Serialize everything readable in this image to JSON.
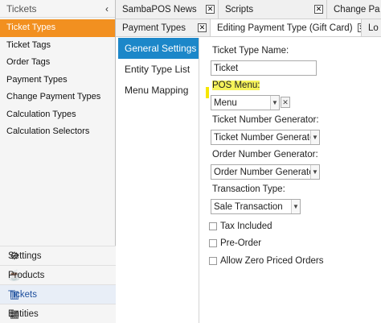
{
  "sidebar": {
    "title": "Tickets",
    "items": [
      {
        "label": "Ticket Types"
      },
      {
        "label": "Ticket Tags"
      },
      {
        "label": "Order Tags"
      },
      {
        "label": "Payment Types"
      },
      {
        "label": "Change Payment Types"
      },
      {
        "label": "Calculation Types"
      },
      {
        "label": "Calculation Selectors"
      }
    ],
    "bottom": [
      {
        "label": "Settings",
        "icon": "gear-icon"
      },
      {
        "label": "Products",
        "icon": "cup-icon"
      },
      {
        "label": "Tickets",
        "icon": "books-icon"
      },
      {
        "label": "Entities",
        "icon": "table-icon"
      }
    ]
  },
  "tabs_row1": [
    {
      "label": "SambaPOS News"
    },
    {
      "label": "Scripts"
    },
    {
      "label": "Change Pa"
    }
  ],
  "tabs_row2": [
    {
      "label": "Payment Types"
    },
    {
      "label": "Editing Payment Type (Gift Card)"
    },
    {
      "label": "Lo"
    }
  ],
  "vmenu": [
    {
      "label": "General Settings"
    },
    {
      "label": "Entity Type List"
    },
    {
      "label": "Menu Mapping"
    }
  ],
  "form": {
    "ticket_type_name_label": "Ticket Type Name:",
    "ticket_type_name_value": "Ticket",
    "pos_menu_label": "POS Menu:",
    "pos_menu_value": "Menu",
    "ticket_number_generator_label": "Ticket Number Generator:",
    "ticket_number_generator_value": "Ticket Number Generator",
    "order_number_generator_label": "Order Number Generator:",
    "order_number_generator_value": "Order Number Generator",
    "transaction_type_label": "Transaction Type:",
    "transaction_type_value": "Sale Transaction",
    "tax_included_label": "Tax Included",
    "pre_order_label": "Pre-Order",
    "allow_zero_label": "Allow Zero Priced Orders"
  },
  "colors": {
    "active_sidebar": "#f29020",
    "active_vmenu": "#1c87c9",
    "highlight": "#f6f35a"
  }
}
